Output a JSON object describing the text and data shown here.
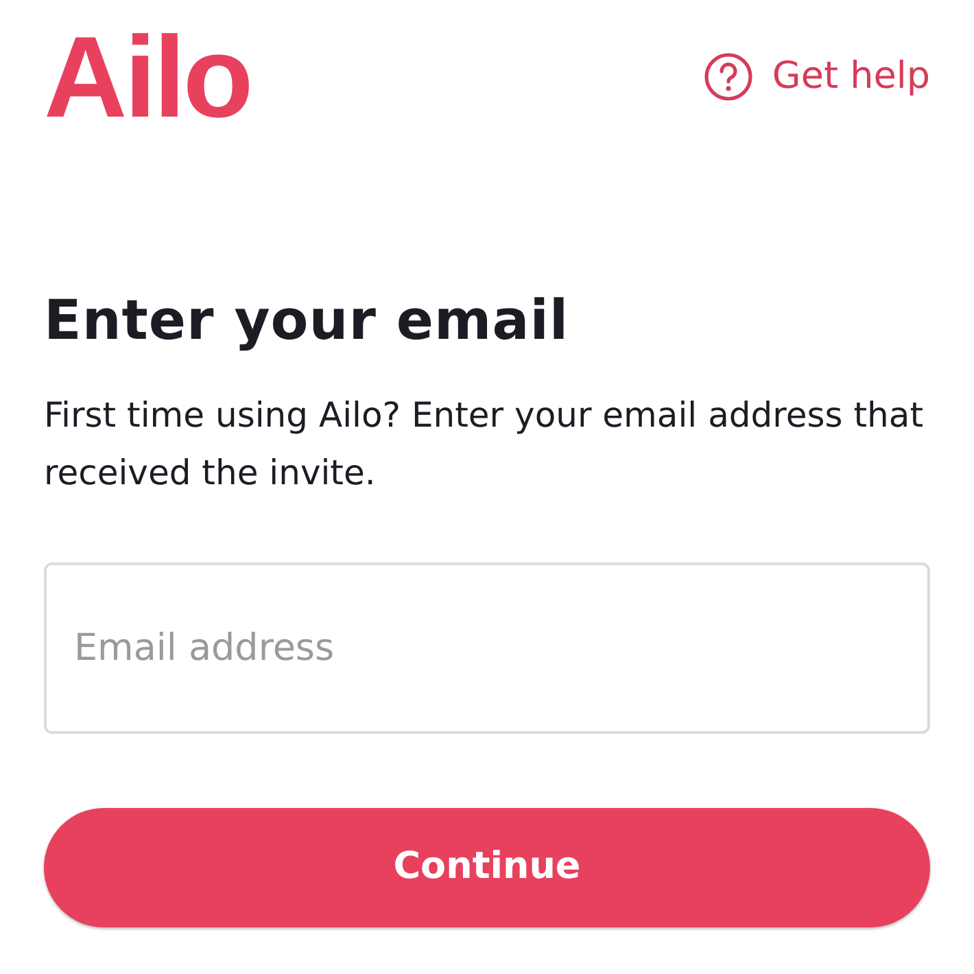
{
  "header": {
    "logo": "Ailo",
    "help_link": "Get help"
  },
  "title": "Enter your email",
  "description": "First time using Ailo? Enter your email address that received the invite.",
  "email_field": {
    "placeholder": "Email address"
  },
  "buttons": [
    "Continue"
  ]
}
